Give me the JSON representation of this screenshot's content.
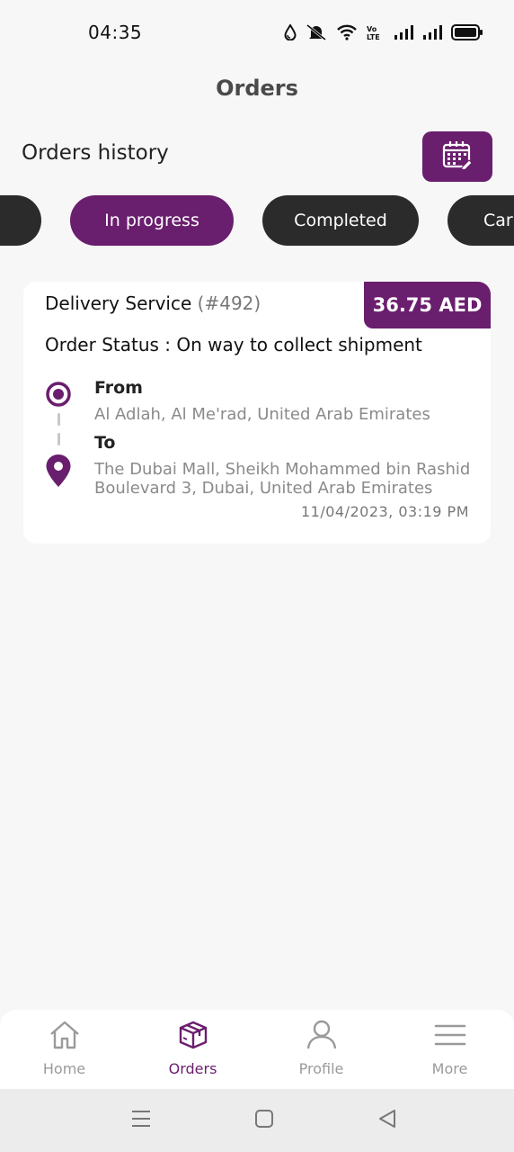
{
  "status_bar": {
    "time": "04:35",
    "icons": [
      "water-drop-icon",
      "bell-muted-icon",
      "wifi-icon",
      "volte-icon",
      "signal-icon",
      "signal-icon",
      "battery-icon"
    ]
  },
  "header": {
    "title": "Orders"
  },
  "section": {
    "title": "Orders history",
    "calendar_icon": "calendar-icon"
  },
  "filters": {
    "items": [
      {
        "label": ""
      },
      {
        "label": "In progress",
        "active": true
      },
      {
        "label": "Completed"
      },
      {
        "label": "Car"
      }
    ]
  },
  "order": {
    "service": "Delivery Service",
    "number": "(#492)",
    "price": "36.75 AED",
    "status": "Order Status : On way to collect shipment",
    "from_label": "From",
    "from_address": "Al Adlah, Al Me'rad, United Arab Emirates",
    "to_label": "To",
    "to_address": "The Dubai Mall, Sheikh Mohammed bin Rashid Boulevard 3, Dubai, United Arab Emirates",
    "datetime": "11/04/2023, 03:19 PM"
  },
  "bottom_nav": {
    "items": [
      {
        "label": "Home",
        "icon": "home-icon"
      },
      {
        "label": "Orders",
        "icon": "box-icon",
        "active": true
      },
      {
        "label": "Profile",
        "icon": "user-icon"
      },
      {
        "label": "More",
        "icon": "menu-icon"
      }
    ]
  },
  "colors": {
    "brand": "#6a1e6e",
    "pill_dark": "#2b2b2b",
    "background": "#f7f7f7"
  }
}
